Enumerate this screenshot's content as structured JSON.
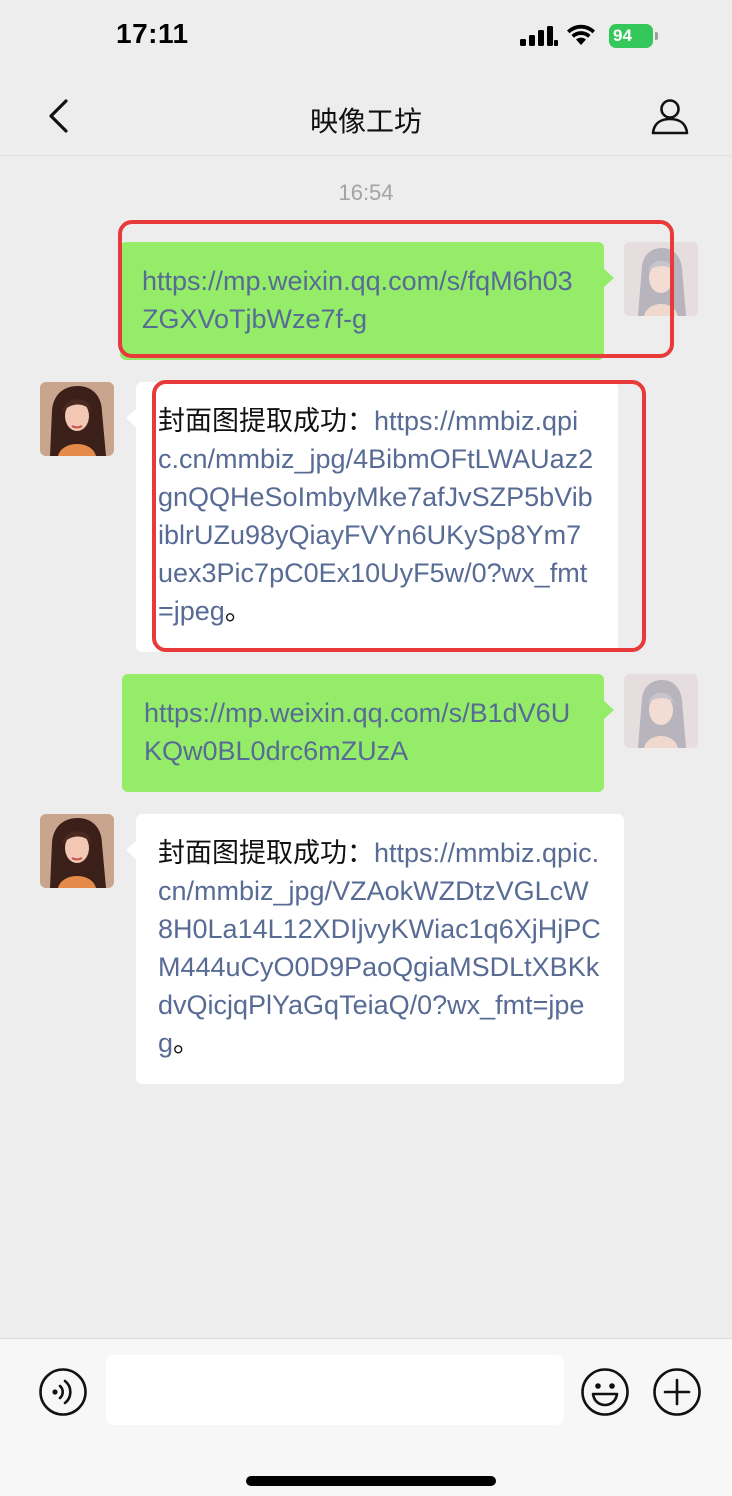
{
  "status_bar": {
    "time": "17:11",
    "battery": "94",
    "icons": [
      "signal-icon",
      "wifi-icon",
      "battery-icon"
    ]
  },
  "nav": {
    "title": "映像工坊",
    "icons": [
      "back-icon",
      "profile-icon"
    ]
  },
  "chat": {
    "timestamp": "16:54",
    "messages": [
      {
        "side": "right",
        "text": "https://mp.weixin.qq.com/s/fqM6h03ZGXVoTjbWze7f-g",
        "highlighted": true
      },
      {
        "side": "left",
        "prefix": "封面图提取成功：",
        "link": "https://mmbiz.qpic.cn/mmbiz_jpg/4BibmOFtLWAUaz2gnQQHeSoImbyMke7afJvSZP5bVibiblrUZu98yQiayFVYn6UKySp8Ym7uex3Pic7pC0Ex10UyF5w/0?wx_fmt=jpeg",
        "suffix": "。",
        "highlighted": true
      },
      {
        "side": "right",
        "text": "https://mp.weixin.qq.com/s/B1dV6UKQw0BL0drc6mZUzA",
        "highlighted": false
      },
      {
        "side": "left",
        "prefix": "封面图提取成功：",
        "link": "https://mmbiz.qpic.cn/mmbiz_jpg/VZAokWZDtzVGLcW8H0La14L12XDIjvyKWiac1q6XjHjPCM444uCyO0D9PaoQgiaMSDLtXBKkdvQicjqPlYaGqTeiaQ/0?wx_fmt=jpeg",
        "suffix": "。",
        "highlighted": false
      }
    ]
  },
  "input_bar": {
    "placeholder": "",
    "icons": [
      "voice-icon",
      "emoji-icon",
      "add-icon"
    ]
  },
  "colors": {
    "background": "#ededed",
    "sent_bubble": "#95ec69",
    "received_bubble": "#ffffff",
    "link": "#576b95",
    "highlight": "#e83a3a",
    "battery": "#34c759"
  }
}
